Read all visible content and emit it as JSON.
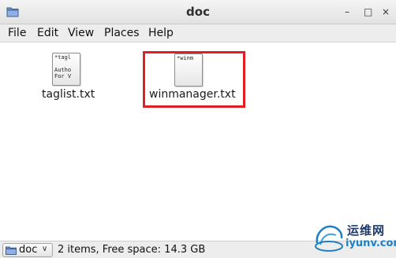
{
  "window": {
    "title": "doc",
    "minimize_glyph": "–",
    "maximize_glyph": "□",
    "close_glyph": "×",
    "icon": "folder-icon"
  },
  "menu": {
    "items": [
      "File",
      "Edit",
      "View",
      "Places",
      "Help"
    ]
  },
  "files": [
    {
      "name": "taglist.txt",
      "preview": "*tagl\n\nAutho\nFor V",
      "icon": "text-file-icon"
    },
    {
      "name": "winmanager.txt",
      "preview": "*winm",
      "icon": "text-file-icon",
      "highlighted": true
    }
  ],
  "highlight_color": "#e01e24",
  "statusbar": {
    "location": "doc",
    "location_icon": "folder-icon",
    "status": "2 items, Free space: 14.3 GB"
  },
  "watermark": {
    "chinese": "运维网",
    "url": "iyunv.com"
  }
}
